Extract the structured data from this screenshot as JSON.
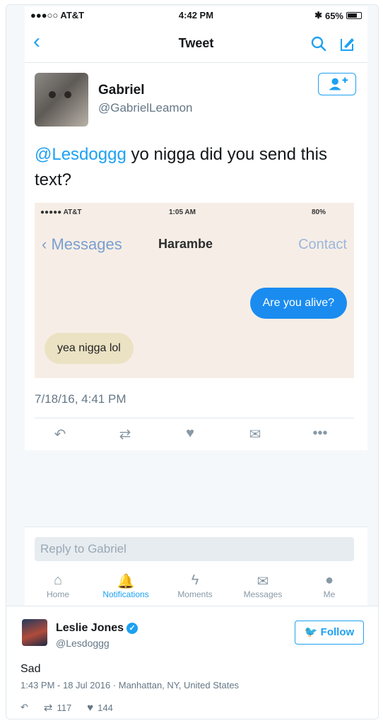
{
  "status_bar": {
    "carrier": "●●●○○ AT&T",
    "time": "4:42 PM",
    "battery": "65%"
  },
  "navbar": {
    "title": "Tweet",
    "back_icon": "chevron-left-icon"
  },
  "tweet": {
    "name": "Gabriel",
    "handle": "@GabrielLeamon",
    "mention": "@Lesdoggg",
    "text": " yo nigga did you send this text?",
    "timestamp": "7/18/16, 4:41 PM"
  },
  "media": {
    "status_time": "1:05 AM",
    "status_battery": "80%",
    "back_label": "Messages",
    "contact_name": "Harambe",
    "contact_label": "Contact",
    "outgoing": "Are you alive?",
    "incoming": "yea nigga lol"
  },
  "reply": {
    "placeholder": "Reply to Gabriel"
  },
  "tabs": [
    {
      "label": "Home",
      "icon": "⌂"
    },
    {
      "label": "Notifications",
      "icon": "🔔"
    },
    {
      "label": "Moments",
      "icon": "ϟ"
    },
    {
      "label": "Messages",
      "icon": "✉"
    },
    {
      "label": "Me",
      "icon": "●"
    }
  ],
  "outer": {
    "name": "Leslie Jones",
    "handle": "@Lesdoggg",
    "follow_label": "Follow",
    "text": "Sad",
    "meta": "1:43 PM - 18 Jul 2016 · Manhattan, NY, United States",
    "retweets": "117",
    "likes": "144"
  },
  "colors": {
    "accent": "#1da1f2",
    "imessage_blue": "#1a8cf0"
  }
}
